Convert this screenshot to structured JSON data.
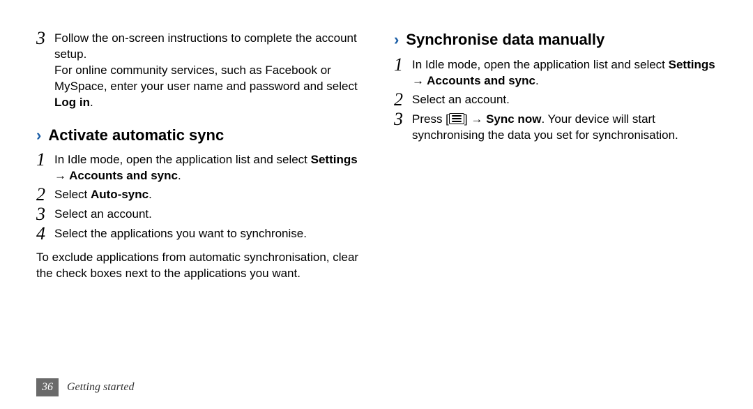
{
  "leftCol": {
    "step3_line1": "Follow the on-screen instructions to complete the account setup.",
    "step3_line2a": "For online community services, such as Facebook or MySpace, enter your user name and password and select ",
    "step3_login": "Log in",
    "step3_line2b": ".",
    "section_title": "Activate automatic sync",
    "s1a": "In Idle mode, open the application list and select ",
    "s1b": "Settings → Accounts and sync",
    "s1c": ".",
    "s2a": "Select ",
    "s2b": "Auto-sync",
    "s2c": ".",
    "s3": "Select an account.",
    "s4": "Select the applications you want to synchronise.",
    "note": "To exclude applications from automatic synchronisation, clear the check boxes next to the applications you want."
  },
  "rightCol": {
    "section_title": "Synchronise data manually",
    "s1a": "In Idle mode, open the application list and select ",
    "s1b": "Settings → Accounts and sync",
    "s1c": ".",
    "s2": "Select an account.",
    "s3a": "Press [",
    "s3b": "] → ",
    "s3c": "Sync now",
    "s3d": ". Your device will start synchronising the data you set for synchronisation."
  },
  "nums": {
    "n1": "1",
    "n2": "2",
    "n3": "3",
    "n4": "4"
  },
  "chevron": "›",
  "footer": {
    "page": "36",
    "section": "Getting started"
  }
}
